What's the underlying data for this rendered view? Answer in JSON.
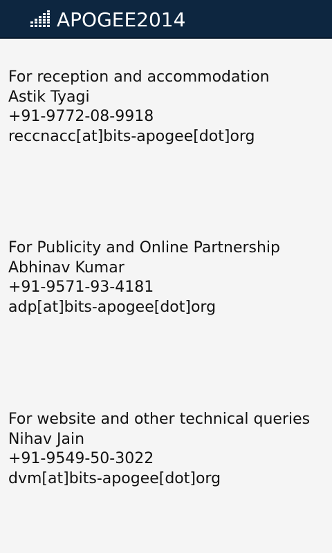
{
  "header": {
    "logo_text": "APOGEE2014",
    "logo_icon": "equalizer-bars-icon",
    "background_color": "#0d2640"
  },
  "contacts": [
    {
      "heading": "For reception and accommodation",
      "name": "Astik Tyagi",
      "phone": "+91-9772-08-9918",
      "email": "reccnacc[at]bits-apogee[dot]org"
    },
    {
      "heading": "For Publicity and Online Partnership",
      "name": "Abhinav Kumar",
      "phone": "+91-9571-93-4181",
      "email": "adp[at]bits-apogee[dot]org"
    },
    {
      "heading": "For website and other technical queries",
      "name": "Nihav Jain",
      "phone": "+91-9549-50-3022",
      "email": "dvm[at]bits-apogee[dot]org"
    }
  ]
}
